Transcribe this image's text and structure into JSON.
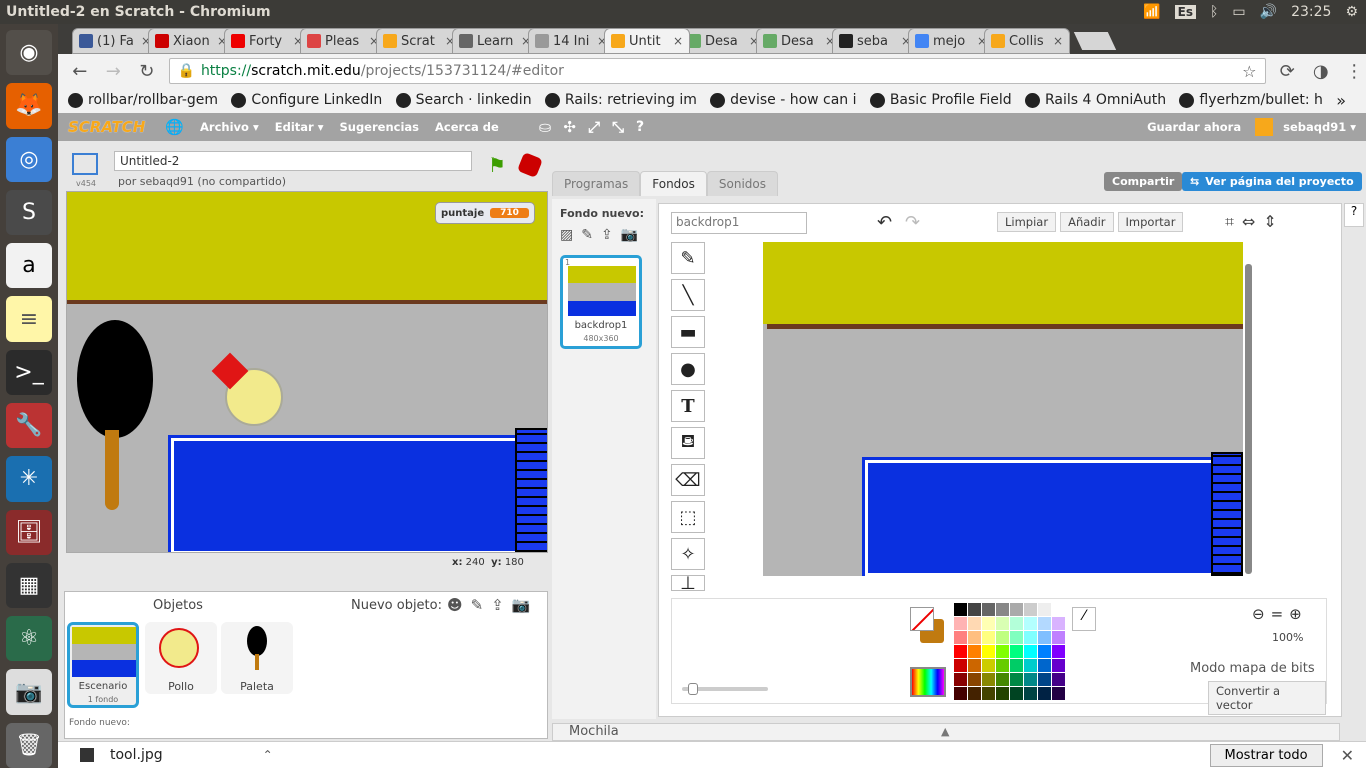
{
  "window": {
    "title": "Untitled-2 en Scratch - Chromium"
  },
  "tray": {
    "lang": "Es",
    "time": "23:25"
  },
  "tabs": [
    {
      "label": "(1) Fa",
      "color": "#3b5998"
    },
    {
      "label": "Xiaon",
      "color": "#c00"
    },
    {
      "label": "Forty",
      "color": "#e00"
    },
    {
      "label": "Pleas",
      "color": "#d44"
    },
    {
      "label": "Scrat",
      "color": "#f7a81b"
    },
    {
      "label": "Learn",
      "color": "#666"
    },
    {
      "label": "14 Ini",
      "color": "#999"
    },
    {
      "label": "Untit",
      "color": "#f7a81b"
    },
    {
      "label": "Desa",
      "color": "#6a6"
    },
    {
      "label": "Desa",
      "color": "#6a6"
    },
    {
      "label": "seba",
      "color": "#222"
    },
    {
      "label": "mejo",
      "color": "#4285f4"
    },
    {
      "label": "Collis",
      "color": "#f7a81b"
    }
  ],
  "url": {
    "scheme": "https://",
    "host": "scratch.mit.edu",
    "path": "/projects/153731124/#editor"
  },
  "bookmarks": [
    "rollbar/rollbar-gem",
    "Configure LinkedIn",
    "Search · linkedin",
    "Rails: retrieving im",
    "devise - how can i",
    "Basic Profile Field",
    "Rails 4 OmniAuth",
    "flyerhzm/bullet: h"
  ],
  "scratch": {
    "logo": "SCRATCH",
    "menus": [
      "Archivo ▾",
      "Editar ▾",
      "Sugerencias",
      "Acerca de"
    ],
    "save": "Guardar ahora",
    "user": "sebaqd91 ▾",
    "share": "Compartir",
    "view_project": "Ver página del proyecto"
  },
  "project": {
    "title": "Untitled-2",
    "byline": "por sebaqd91 (no compartido)",
    "version": "v454"
  },
  "stage": {
    "var_name": "puntaje",
    "var_value": "710",
    "x_label": "x:",
    "x": "240",
    "y_label": "y:",
    "y": "180"
  },
  "sprites": {
    "title": "Objetos",
    "new_label": "Nuevo objeto:",
    "stage_label": "Escenario",
    "stage_sub": "1 fondo",
    "new_backdrop": "Fondo nuevo:",
    "items": [
      "Pollo",
      "Paleta"
    ]
  },
  "panel_tabs": [
    "Programas",
    "Fondos",
    "Sonidos"
  ],
  "costumes": {
    "new_label": "Fondo nuevo:",
    "item_name": "backdrop1",
    "item_size": "480x360",
    "item_index": "1"
  },
  "paint": {
    "name_value": "backdrop1",
    "clear": "Limpiar",
    "add": "Añadir",
    "import": "Importar",
    "zoom": "100%",
    "mode": "Modo mapa de bits",
    "convert": "Convertir a vector"
  },
  "backpack": "Mochila",
  "downloads": {
    "file": "tool.jpg",
    "show_all": "Mostrar todo"
  }
}
